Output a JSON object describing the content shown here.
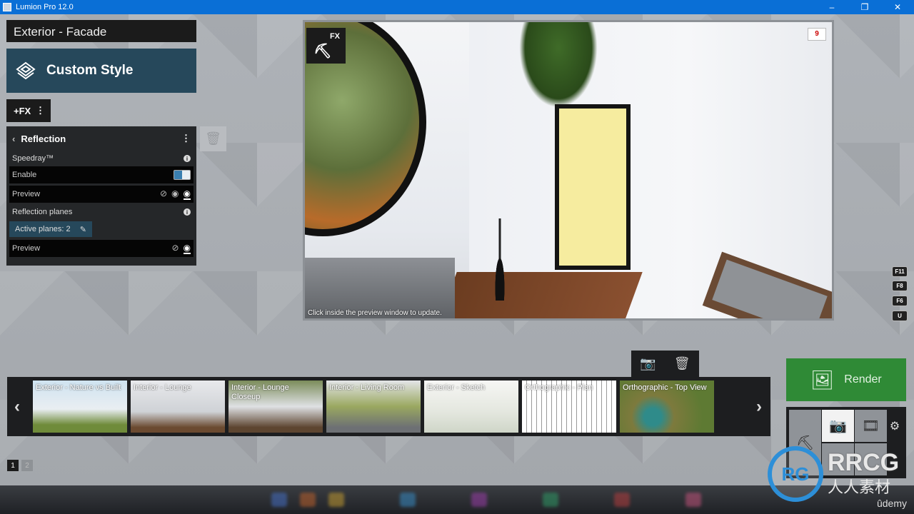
{
  "window": {
    "title": "Lumion Pro 12.0",
    "controls": [
      "–",
      "❐",
      "✕"
    ]
  },
  "scene": {
    "name": "Exterior - Facade",
    "style_label": "Custom Style",
    "fx_label": "+FX"
  },
  "effect_panel": {
    "title": "Reflection",
    "speedray_label": "Speedray™",
    "enable_label": "Enable",
    "enable_on": true,
    "preview_label": "Preview",
    "planes_label": "Reflection planes",
    "active_planes": "Active planes: 2",
    "preview2_label": "Preview"
  },
  "preview": {
    "fx_badge": "FX",
    "count_badge": "9",
    "hint": "Click inside the preview window to update."
  },
  "hotkeys": [
    "F11",
    "F8",
    "F6",
    "U"
  ],
  "thumbnails": [
    {
      "label": "Exterior - Nature vs Built",
      "bg": "linear-gradient(180deg,#cfe3f0,#e9eef2 55%,#6f8b3a 85%)"
    },
    {
      "label": "Interior - Lounge",
      "bg": "linear-gradient(180deg,#e8e9ec,#cfd2d6 60%,#6b4a30 90%)"
    },
    {
      "label": "Interior - Lounge Closeup",
      "bg": "linear-gradient(180deg,#7b8c5a,#dfe1e4 50%,#5d4530 90%)"
    },
    {
      "label": "Interior - Living Room",
      "bg": "linear-gradient(180deg,#e3e5e8,#9aa860 50%,#6d7074 90%)"
    },
    {
      "label": "Exterior - Sketch",
      "bg": "linear-gradient(180deg,#f6f6f4,#e4e7df 60%,#cfd6c8)"
    },
    {
      "label": "Orthographic - Plan",
      "bg": "repeating-linear-gradient(90deg,#fff 0 6px,#999 6px 7px)"
    },
    {
      "label": "Orthographic - Top View",
      "bg": "radial-gradient(circle at 35% 70%,#2f8b8a 12%,#7d7a3d 30%,#5e7a33 70%)"
    }
  ],
  "pages": [
    "1",
    "2"
  ],
  "render": {
    "label": "Render",
    "color": "#2f8a36"
  },
  "watermark": {
    "logo": "RRCG",
    "sub": "人人素材"
  },
  "udemy": "ûdemy",
  "colors": {
    "accent": "#26485b",
    "panel": "#252729"
  }
}
